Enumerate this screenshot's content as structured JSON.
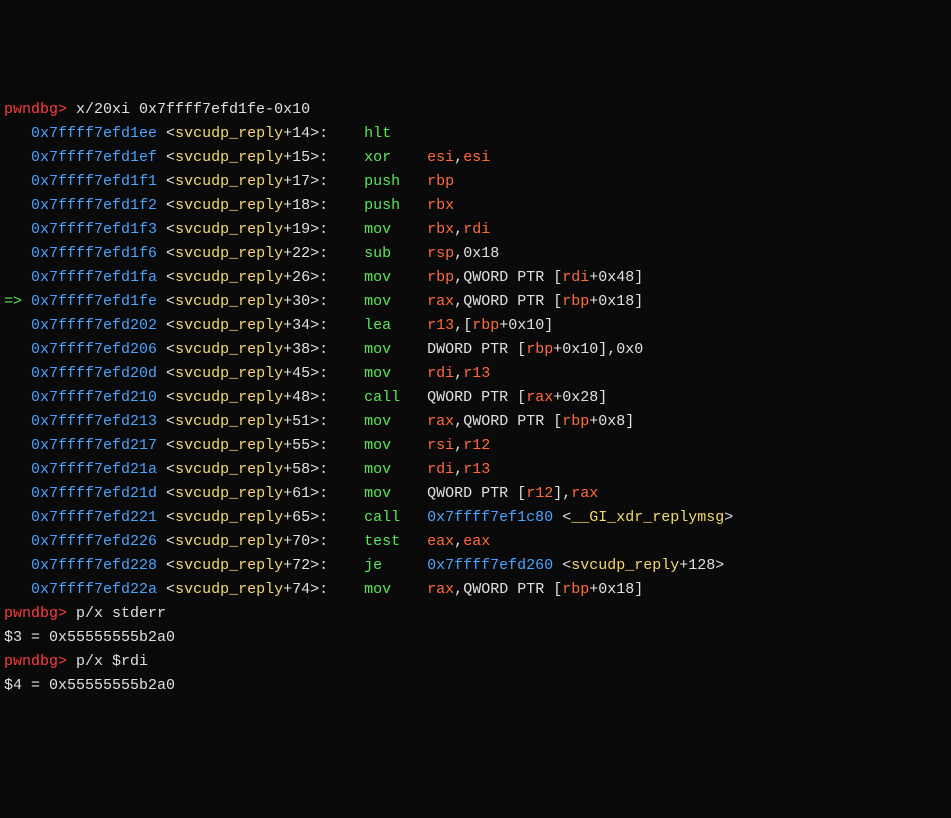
{
  "prompt": "pwndbg>",
  "commands": {
    "cmd1": "x/20xi 0x7ffff7efd1fe-0x10",
    "cmd2": "p/x stderr",
    "cmd3": "p/x $rdi"
  },
  "arrow": "=>",
  "current_index": 7,
  "disasm": [
    {
      "addr": "0x7ffff7efd1ee",
      "sym": "svcudp_reply",
      "off": "14",
      "mn": "hlt",
      "ops": []
    },
    {
      "addr": "0x7ffff7efd1ef",
      "sym": "svcudp_reply",
      "off": "15",
      "mn": "xor",
      "ops": [
        {
          "t": "reg",
          "v": "esi"
        },
        {
          "t": "comma"
        },
        {
          "t": "reg",
          "v": "esi"
        }
      ]
    },
    {
      "addr": "0x7ffff7efd1f1",
      "sym": "svcudp_reply",
      "off": "17",
      "mn": "push",
      "ops": [
        {
          "t": "reg",
          "v": "rbp"
        }
      ]
    },
    {
      "addr": "0x7ffff7efd1f2",
      "sym": "svcudp_reply",
      "off": "18",
      "mn": "push",
      "ops": [
        {
          "t": "reg",
          "v": "rbx"
        }
      ]
    },
    {
      "addr": "0x7ffff7efd1f3",
      "sym": "svcudp_reply",
      "off": "19",
      "mn": "mov",
      "ops": [
        {
          "t": "reg",
          "v": "rbx"
        },
        {
          "t": "comma"
        },
        {
          "t": "reg",
          "v": "rdi"
        }
      ]
    },
    {
      "addr": "0x7ffff7efd1f6",
      "sym": "svcudp_reply",
      "off": "22",
      "mn": "sub",
      "ops": [
        {
          "t": "reg",
          "v": "rsp"
        },
        {
          "t": "comma"
        },
        {
          "t": "imm",
          "v": "0x18"
        }
      ]
    },
    {
      "addr": "0x7ffff7efd1fa",
      "sym": "svcudp_reply",
      "off": "26",
      "mn": "mov",
      "ops": [
        {
          "t": "reg",
          "v": "rbp"
        },
        {
          "t": "comma"
        },
        {
          "t": "txt",
          "v": "QWORD PTR ["
        },
        {
          "t": "reg",
          "v": "rdi"
        },
        {
          "t": "txt",
          "v": "+"
        },
        {
          "t": "imm",
          "v": "0x48"
        },
        {
          "t": "txt",
          "v": "]"
        }
      ]
    },
    {
      "addr": "0x7ffff7efd1fe",
      "sym": "svcudp_reply",
      "off": "30",
      "mn": "mov",
      "ops": [
        {
          "t": "reg",
          "v": "rax"
        },
        {
          "t": "comma"
        },
        {
          "t": "txt",
          "v": "QWORD PTR ["
        },
        {
          "t": "reg",
          "v": "rbp"
        },
        {
          "t": "txt",
          "v": "+"
        },
        {
          "t": "imm",
          "v": "0x18"
        },
        {
          "t": "txt",
          "v": "]"
        }
      ]
    },
    {
      "addr": "0x7ffff7efd202",
      "sym": "svcudp_reply",
      "off": "34",
      "mn": "lea",
      "ops": [
        {
          "t": "reg",
          "v": "r13"
        },
        {
          "t": "comma"
        },
        {
          "t": "txt",
          "v": "["
        },
        {
          "t": "reg",
          "v": "rbp"
        },
        {
          "t": "txt",
          "v": "+"
        },
        {
          "t": "imm",
          "v": "0x10"
        },
        {
          "t": "txt",
          "v": "]"
        }
      ]
    },
    {
      "addr": "0x7ffff7efd206",
      "sym": "svcudp_reply",
      "off": "38",
      "mn": "mov",
      "ops": [
        {
          "t": "txt",
          "v": "DWORD PTR ["
        },
        {
          "t": "reg",
          "v": "rbp"
        },
        {
          "t": "txt",
          "v": "+"
        },
        {
          "t": "imm",
          "v": "0x10"
        },
        {
          "t": "txt",
          "v": "],"
        },
        {
          "t": "imm",
          "v": "0x0"
        }
      ]
    },
    {
      "addr": "0x7ffff7efd20d",
      "sym": "svcudp_reply",
      "off": "45",
      "mn": "mov",
      "ops": [
        {
          "t": "reg",
          "v": "rdi"
        },
        {
          "t": "comma"
        },
        {
          "t": "reg",
          "v": "r13"
        }
      ]
    },
    {
      "addr": "0x7ffff7efd210",
      "sym": "svcudp_reply",
      "off": "48",
      "mn": "call",
      "ops": [
        {
          "t": "txt",
          "v": "QWORD PTR ["
        },
        {
          "t": "reg",
          "v": "rax"
        },
        {
          "t": "txt",
          "v": "+"
        },
        {
          "t": "imm",
          "v": "0x28"
        },
        {
          "t": "txt",
          "v": "]"
        }
      ]
    },
    {
      "addr": "0x7ffff7efd213",
      "sym": "svcudp_reply",
      "off": "51",
      "mn": "mov",
      "ops": [
        {
          "t": "reg",
          "v": "rax"
        },
        {
          "t": "comma"
        },
        {
          "t": "txt",
          "v": "QWORD PTR ["
        },
        {
          "t": "reg",
          "v": "rbp"
        },
        {
          "t": "txt",
          "v": "+"
        },
        {
          "t": "imm",
          "v": "0x8"
        },
        {
          "t": "txt",
          "v": "]"
        }
      ]
    },
    {
      "addr": "0x7ffff7efd217",
      "sym": "svcudp_reply",
      "off": "55",
      "mn": "mov",
      "ops": [
        {
          "t": "reg",
          "v": "rsi"
        },
        {
          "t": "comma"
        },
        {
          "t": "reg",
          "v": "r12"
        }
      ]
    },
    {
      "addr": "0x7ffff7efd21a",
      "sym": "svcudp_reply",
      "off": "58",
      "mn": "mov",
      "ops": [
        {
          "t": "reg",
          "v": "rdi"
        },
        {
          "t": "comma"
        },
        {
          "t": "reg",
          "v": "r13"
        }
      ]
    },
    {
      "addr": "0x7ffff7efd21d",
      "sym": "svcudp_reply",
      "off": "61",
      "mn": "mov",
      "ops": [
        {
          "t": "txt",
          "v": "QWORD PTR ["
        },
        {
          "t": "reg",
          "v": "r12"
        },
        {
          "t": "txt",
          "v": "],"
        },
        {
          "t": "reg",
          "v": "rax"
        }
      ]
    },
    {
      "addr": "0x7ffff7efd221",
      "sym": "svcudp_reply",
      "off": "65",
      "mn": "call",
      "ops": [
        {
          "t": "addr",
          "v": "0x7ffff7ef1c80"
        },
        {
          "t": "txt",
          "v": " <"
        },
        {
          "t": "sym",
          "v": "__GI_xdr_replymsg"
        },
        {
          "t": "txt",
          "v": ">"
        }
      ]
    },
    {
      "addr": "0x7ffff7efd226",
      "sym": "svcudp_reply",
      "off": "70",
      "mn": "test",
      "ops": [
        {
          "t": "reg",
          "v": "eax"
        },
        {
          "t": "comma"
        },
        {
          "t": "reg",
          "v": "eax"
        }
      ]
    },
    {
      "addr": "0x7ffff7efd228",
      "sym": "svcudp_reply",
      "off": "72",
      "mn": "je",
      "ops": [
        {
          "t": "addr",
          "v": "0x7ffff7efd260"
        },
        {
          "t": "txt",
          "v": " <"
        },
        {
          "t": "sym",
          "v": "svcudp_reply"
        },
        {
          "t": "txt",
          "v": "+"
        },
        {
          "t": "imm",
          "v": "128"
        },
        {
          "t": "txt",
          "v": ">"
        }
      ]
    },
    {
      "addr": "0x7ffff7efd22a",
      "sym": "svcudp_reply",
      "off": "74",
      "mn": "mov",
      "ops": [
        {
          "t": "reg",
          "v": "rax"
        },
        {
          "t": "comma"
        },
        {
          "t": "txt",
          "v": "QWORD PTR ["
        },
        {
          "t": "reg",
          "v": "rbp"
        },
        {
          "t": "txt",
          "v": "+"
        },
        {
          "t": "imm",
          "v": "0x18"
        },
        {
          "t": "txt",
          "v": "]"
        }
      ]
    }
  ],
  "results": {
    "r1": "$3 = 0x55555555b2a0",
    "r2": "$4 = 0x55555555b2a0"
  }
}
